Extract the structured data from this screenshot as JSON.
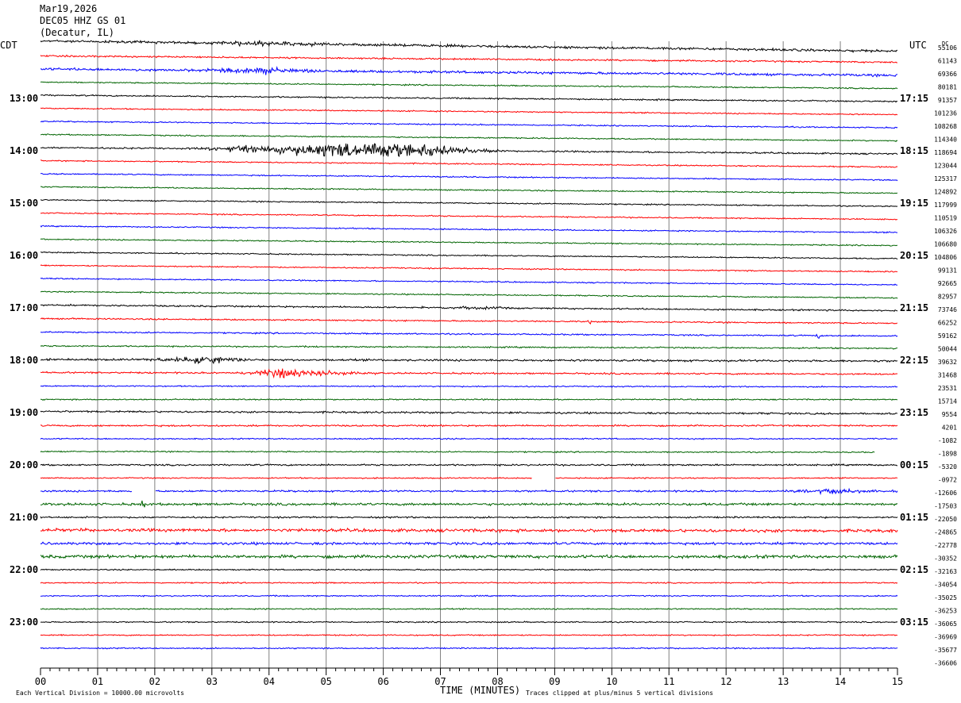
{
  "header": {
    "date": "Mar19,2026",
    "station": "DEC05 HHZ GS 01",
    "location": "(Decatur, IL)"
  },
  "left_axis_label": "CDT",
  "right_axis_label": "UTC",
  "dc_label": "DC",
  "footer": {
    "scale_note": "Each Vertical Division = 10000.00 microvolts",
    "x_axis_title": "TIME (MINUTES)",
    "clip_note": "Traces clipped at plus/minus 5 vertical divisions"
  },
  "colors": {
    "trace_cycle": [
      "#000000",
      "#ff0000",
      "#0000ff",
      "#006400"
    ],
    "grid": "#808080",
    "text": "#000000"
  },
  "chart_data": {
    "type": "line",
    "title": "DEC05 HHZ GS 01",
    "xlabel": "TIME (MINUTES)",
    "ylabel": "",
    "xlim": [
      0,
      15
    ],
    "x_ticks": [
      "00",
      "01",
      "02",
      "03",
      "04",
      "05",
      "06",
      "07",
      "08",
      "09",
      "10",
      "11",
      "12",
      "13",
      "14",
      "15"
    ],
    "x_minor_per_major": 6,
    "trace_count": 47,
    "traces_per_hour": 4,
    "left_hour_labels": [
      {
        "trace": 4,
        "label": "13:00"
      },
      {
        "trace": 8,
        "label": "14:00"
      },
      {
        "trace": 12,
        "label": "15:00"
      },
      {
        "trace": 16,
        "label": "16:00"
      },
      {
        "trace": 20,
        "label": "17:00"
      },
      {
        "trace": 24,
        "label": "18:00"
      },
      {
        "trace": 28,
        "label": "19:00"
      },
      {
        "trace": 32,
        "label": "20:00"
      },
      {
        "trace": 36,
        "label": "21:00"
      },
      {
        "trace": 40,
        "label": "22:00"
      },
      {
        "trace": 44,
        "label": "23:00"
      }
    ],
    "right_hour_labels": [
      {
        "trace": 4,
        "label": "17:15"
      },
      {
        "trace": 8,
        "label": "18:15"
      },
      {
        "trace": 12,
        "label": "19:15"
      },
      {
        "trace": 16,
        "label": "20:15"
      },
      {
        "trace": 20,
        "label": "21:15"
      },
      {
        "trace": 24,
        "label": "22:15"
      },
      {
        "trace": 28,
        "label": "23:15"
      },
      {
        "trace": 32,
        "label": "00:15"
      },
      {
        "trace": 36,
        "label": "01:15"
      },
      {
        "trace": 40,
        "label": "02:15"
      },
      {
        "trace": 44,
        "label": "03:15"
      }
    ],
    "dc_offsets": [
      "55106",
      "61143",
      "69366",
      "80181",
      "91357",
      "101236",
      "108268",
      "114340",
      "118694",
      "123044",
      "125317",
      "124892",
      "117999",
      "110519",
      "106326",
      "106680",
      "104806",
      "99131",
      "92665",
      "82957",
      "73746",
      "66252",
      "59162",
      "50044",
      "39632",
      "31468",
      "23531",
      "15714",
      "9554",
      "4201",
      "-1082",
      "-1898",
      "-5320",
      "-0972",
      "-12606",
      "-17503",
      "-22050",
      "-24865",
      "-22778",
      "-30352",
      "-32163",
      "-34054",
      "-35025",
      "-36253",
      "-36065",
      "-36969",
      "-35677",
      "-36606"
    ],
    "trace_drift": [
      -13,
      -8,
      -8,
      -8,
      -8,
      -8,
      -8,
      -8,
      -8,
      -8,
      -8,
      -8,
      -8,
      -8,
      -8,
      -8,
      -8,
      -8,
      -8,
      -8,
      -7,
      -6,
      -5,
      -3,
      -2,
      -2,
      -1,
      0,
      -3,
      0,
      0,
      -1,
      0,
      0,
      0,
      0,
      0,
      -1,
      0,
      0,
      0,
      0,
      0,
      0,
      0,
      0,
      0
    ],
    "trace_noise": [
      1.2,
      0.8,
      1.2,
      0.6,
      0.7,
      0.6,
      0.6,
      0.6,
      0.8,
      0.6,
      0.6,
      0.6,
      0.6,
      0.6,
      0.6,
      0.6,
      0.6,
      0.6,
      0.6,
      0.6,
      0.8,
      0.7,
      0.7,
      0.7,
      1.0,
      0.8,
      0.6,
      0.6,
      0.9,
      0.8,
      0.6,
      0.6,
      0.8,
      0.6,
      0.9,
      1.2,
      0.8,
      1.5,
      1.2,
      1.5,
      0.6,
      0.6,
      0.6,
      0.6,
      0.6,
      0.6,
      0.6,
      0.6
    ],
    "trace_end_minute": [
      15,
      15,
      15,
      15,
      15,
      15,
      15,
      15,
      15,
      15,
      15,
      15,
      15,
      15,
      15,
      15,
      15,
      15,
      15,
      15,
      15,
      15,
      15,
      15,
      15,
      15,
      15,
      15,
      15,
      15,
      15,
      14.6,
      15,
      15,
      15,
      15,
      15,
      15,
      15,
      15,
      15,
      15,
      15,
      15,
      15,
      15,
      15
    ],
    "events": [
      {
        "trace": 0,
        "start": 2.8,
        "peak": 3.8,
        "end": 5.5,
        "amp": 2.5
      },
      {
        "trace": 2,
        "start": 2.5,
        "peak": 3.9,
        "end": 5.0,
        "amp": 3.5
      },
      {
        "trace": 8,
        "start": 2.3,
        "peak": 6.0,
        "end": 8.3,
        "amp": 9.0
      },
      {
        "trace": 20,
        "start": 6.5,
        "peak": 7.5,
        "end": 8.5,
        "amp": 1.5
      },
      {
        "trace": 24,
        "start": 1.8,
        "peak": 2.6,
        "end": 4.0,
        "amp": 4.0
      },
      {
        "trace": 25,
        "start": 3.3,
        "peak": 4.2,
        "end": 6.0,
        "amp": 4.5
      },
      {
        "trace": 34,
        "start": 12.8,
        "peak": 13.8,
        "end": 15.0,
        "amp": 2.5
      }
    ],
    "gaps": [
      {
        "trace": 33,
        "start": 8.6,
        "end": 9.0
      },
      {
        "trace": 34,
        "start": 1.6,
        "end": 2.0
      }
    ],
    "spikes": [
      {
        "trace": 22,
        "minute": 13.6,
        "amp": 4
      },
      {
        "trace": 21,
        "minute": 9.6,
        "amp": 3
      },
      {
        "trace": 35,
        "minute": 1.8,
        "amp": 4
      }
    ]
  }
}
